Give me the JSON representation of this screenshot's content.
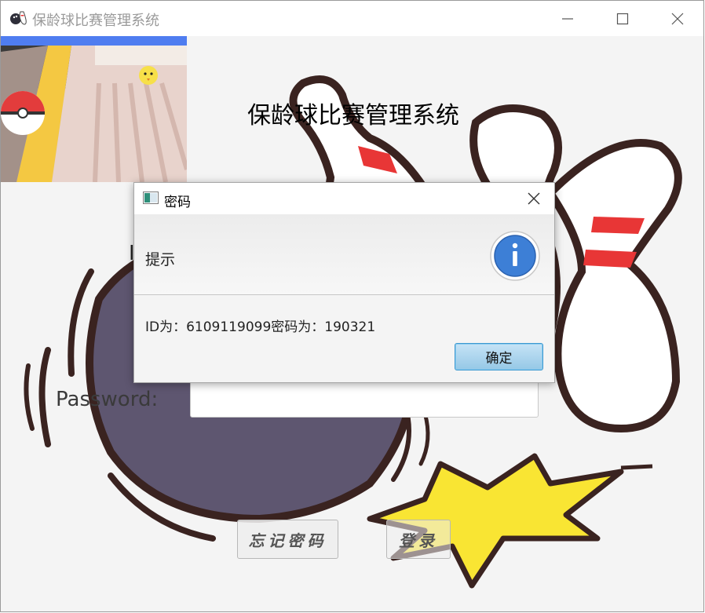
{
  "window": {
    "title": "保龄球比赛管理系统",
    "controls": {
      "minimize": "minimize-icon",
      "maximize": "maximize-icon",
      "close": "close-icon"
    }
  },
  "main": {
    "heading": "保龄球比赛管理系统",
    "partial_label": "I",
    "password_label": "Password:",
    "password_value": "",
    "forgot_button": "忘记密码",
    "login_button": "登录"
  },
  "dialog": {
    "title": "密码",
    "header": "提示",
    "message": "ID为：6109119099密码为：190321",
    "ok_button": "确定",
    "icon": "info-icon"
  },
  "colors": {
    "ok_button_border": "#3c98d0",
    "info_icon": "#3d7fd6",
    "star_yellow": "#f9e533",
    "pin_red": "#e83636",
    "ball": "#5e5670"
  }
}
